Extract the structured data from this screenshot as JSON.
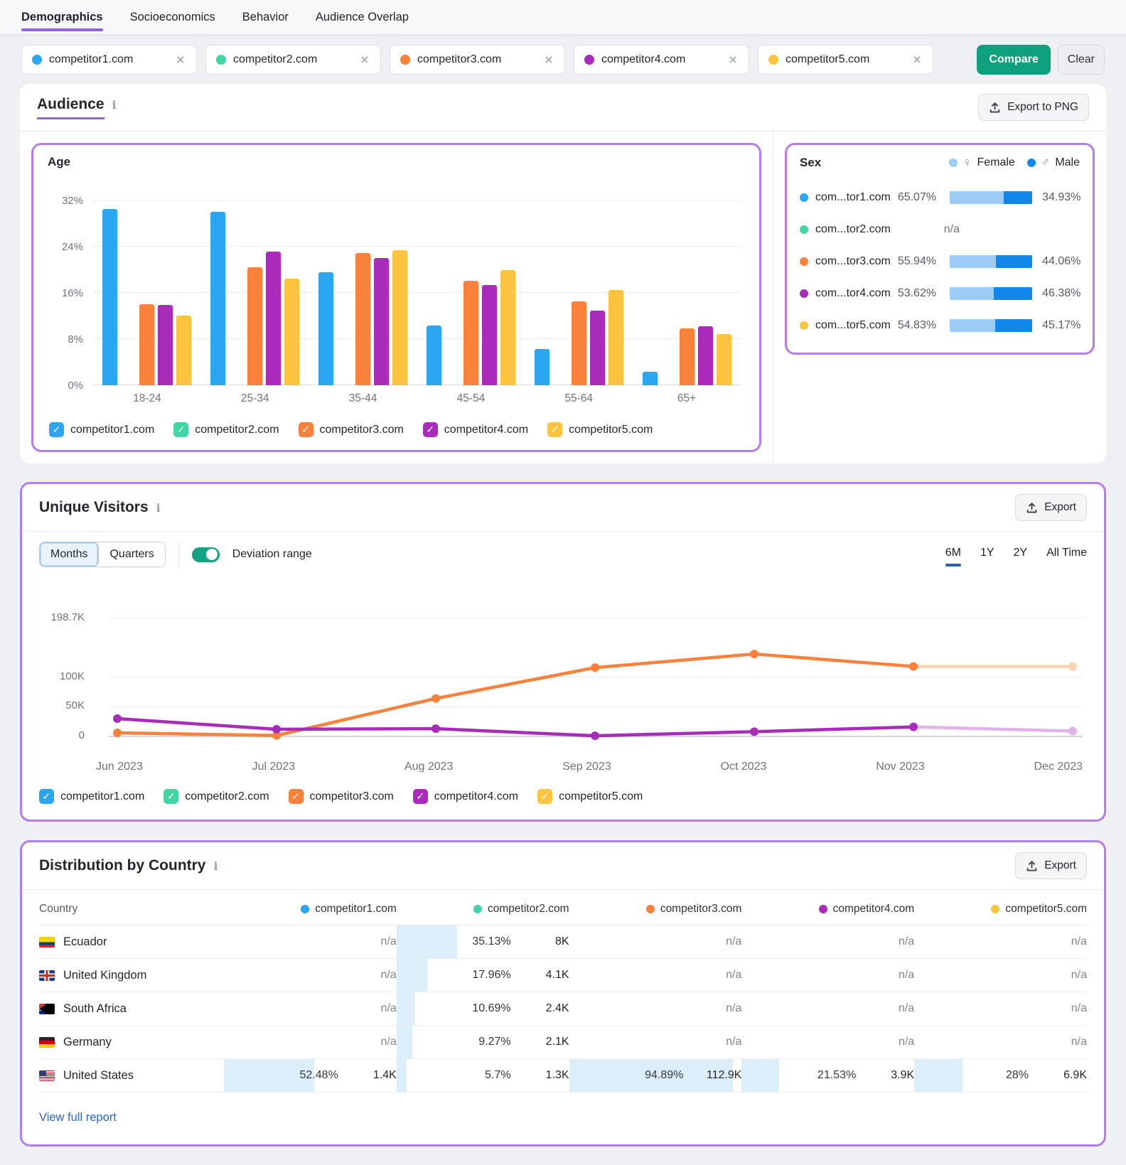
{
  "nav": {
    "tabs": [
      {
        "label": "Demographics",
        "active": true
      },
      {
        "label": "Socioeconomics",
        "active": false
      },
      {
        "label": "Behavior",
        "active": false
      },
      {
        "label": "Audience Overlap",
        "active": false
      }
    ]
  },
  "icons": {
    "close": "×",
    "check": "✓",
    "info": "i"
  },
  "colors": {
    "accent_purple": "#9660dd",
    "panel_border": "#b37ee9",
    "blue": "#2ba6f0",
    "green": "#43d6a4",
    "orange": "#f8813c",
    "magenta": "#a92bba",
    "yellow": "#fbc43e",
    "male_blue": "#1287ea",
    "female_blue": "#9ccbf5",
    "compare_green": "#0fa17e",
    "link_blue": "#2a66c8",
    "highlight_blue": "#ddeefb"
  },
  "competitors": [
    {
      "name": "competitor1.com",
      "color": "#2ba6f0"
    },
    {
      "name": "competitor2.com",
      "color": "#43d6a4"
    },
    {
      "name": "competitor3.com",
      "color": "#f8813c"
    },
    {
      "name": "competitor4.com",
      "color": "#a92bba"
    },
    {
      "name": "competitor5.com",
      "color": "#fbc43e"
    }
  ],
  "toolbar": {
    "compare_label": "Compare",
    "clear_label": "Clear"
  },
  "audience": {
    "title": "Audience",
    "export_label": "Export to PNG",
    "age_title": "Age"
  },
  "sex": {
    "title": "Sex",
    "legend": {
      "female_symbol": "♀",
      "female_label": "Female",
      "male_symbol": "♂",
      "male_label": "Male"
    },
    "rows": [
      {
        "domain": "com...tor1.com",
        "female": "65.07%",
        "male": "34.93%",
        "female_pct": 65.07
      },
      {
        "domain": "com...tor2.com",
        "na": "n/a"
      },
      {
        "domain": "com...tor3.com",
        "female": "55.94%",
        "male": "44.06%",
        "female_pct": 55.94
      },
      {
        "domain": "com...tor4.com",
        "female": "53.62%",
        "male": "46.38%",
        "female_pct": 53.62
      },
      {
        "domain": "com...tor5.com",
        "female": "54.83%",
        "male": "45.17%",
        "female_pct": 54.83
      }
    ]
  },
  "unique_visitors": {
    "title": "Unique Visitors",
    "export_label": "Export",
    "view_toggle": [
      {
        "label": "Months",
        "active": true
      },
      {
        "label": "Quarters",
        "active": false
      }
    ],
    "deviation_label": "Deviation range",
    "deviation_on": true,
    "ranges": [
      {
        "label": "6M",
        "active": true
      },
      {
        "label": "1Y",
        "active": false
      },
      {
        "label": "2Y",
        "active": false
      },
      {
        "label": "All Time",
        "active": false
      }
    ]
  },
  "chart_data": [
    {
      "type": "bar",
      "title": "Age",
      "categories": [
        "18-24",
        "25-34",
        "35-44",
        "45-54",
        "55-64",
        "65+"
      ],
      "series": [
        {
          "name": "competitor1.com",
          "color": "#2ba6f0",
          "values": [
            30.6,
            30.1,
            19.6,
            10.4,
            6.3,
            2.4
          ]
        },
        {
          "name": "competitor2.com",
          "color": "#43d6a4",
          "values": [
            null,
            null,
            null,
            null,
            null,
            null
          ]
        },
        {
          "name": "competitor3.com",
          "color": "#f8813c",
          "values": [
            14.0,
            20.4,
            22.9,
            18.1,
            14.5,
            9.8
          ]
        },
        {
          "name": "competitor4.com",
          "color": "#a92bba",
          "values": [
            13.9,
            23.2,
            22.1,
            17.4,
            12.9,
            10.2
          ]
        },
        {
          "name": "competitor5.com",
          "color": "#fbc43e",
          "values": [
            12.1,
            18.5,
            23.4,
            19.9,
            16.5,
            8.9
          ]
        }
      ],
      "yticks": [
        {
          "label": "0%",
          "value": 0
        },
        {
          "label": "8%",
          "value": 8
        },
        {
          "label": "16%",
          "value": 16
        },
        {
          "label": "24%",
          "value": 24
        },
        {
          "label": "32%",
          "value": 32
        }
      ],
      "ylim": [
        0,
        33
      ],
      "grid": true,
      "legend_position": "bottom",
      "unit": "percent of audience"
    },
    {
      "type": "line",
      "title": "Unique Visitors",
      "x": [
        "Jun 2023",
        "Jul 2023",
        "Aug 2023",
        "Sep 2023",
        "Oct 2023",
        "Nov 2023",
        "Dec 2023"
      ],
      "series": [
        {
          "name": "competitor3.com",
          "color": "#f8813c",
          "faded_color": "#fad4b4",
          "values": [
            6000,
            1500,
            64000,
            116000,
            139000,
            118000,
            118000
          ]
        },
        {
          "name": "competitor4.com",
          "color": "#a92bba",
          "faded_color": "#e0b4ea",
          "values": [
            30000,
            12000,
            13000,
            1000,
            8000,
            16000,
            9000
          ]
        }
      ],
      "yticks": [
        {
          "label": "0",
          "value": 0
        },
        {
          "label": "50K",
          "value": 50000
        },
        {
          "label": "100K",
          "value": 100000
        },
        {
          "label": "198.7K",
          "value": 198700
        }
      ],
      "ylim": [
        0,
        235000
      ],
      "grid": true,
      "note": "Nov-to-Dec segment rendered faded (deviation range projection)"
    }
  ],
  "country": {
    "title": "Distribution by Country",
    "export_label": "Export",
    "country_header": "Country",
    "rows": [
      {
        "country": "Ecuador",
        "flag": "ec",
        "cells": [
          {
            "na": "n/a"
          },
          {
            "pct": "35.13%",
            "value": "8K",
            "fill_pct": 35.13
          },
          {
            "na": "n/a"
          },
          {
            "na": "n/a"
          },
          {
            "na": "n/a"
          }
        ]
      },
      {
        "country": "United Kingdom",
        "flag": "gb",
        "cells": [
          {
            "na": "n/a"
          },
          {
            "pct": "17.96%",
            "value": "4.1K",
            "fill_pct": 17.96
          },
          {
            "na": "n/a"
          },
          {
            "na": "n/a"
          },
          {
            "na": "n/a"
          }
        ]
      },
      {
        "country": "South Africa",
        "flag": "za",
        "cells": [
          {
            "na": "n/a"
          },
          {
            "pct": "10.69%",
            "value": "2.4K",
            "fill_pct": 10.69
          },
          {
            "na": "n/a"
          },
          {
            "na": "n/a"
          },
          {
            "na": "n/a"
          }
        ]
      },
      {
        "country": "Germany",
        "flag": "de",
        "cells": [
          {
            "na": "n/a"
          },
          {
            "pct": "9.27%",
            "value": "2.1K",
            "fill_pct": 9.27
          },
          {
            "na": "n/a"
          },
          {
            "na": "n/a"
          },
          {
            "na": "n/a"
          }
        ]
      },
      {
        "country": "United States",
        "flag": "us",
        "cells": [
          {
            "pct": "52.48%",
            "value": "1.4K",
            "fill_pct": 52.48
          },
          {
            "pct": "5.7%",
            "value": "1.3K",
            "fill_pct": 5.7
          },
          {
            "pct": "94.89%",
            "value": "112.9K",
            "fill_pct": 94.89
          },
          {
            "pct": "21.53%",
            "value": "3.9K",
            "fill_pct": 21.53
          },
          {
            "pct": "28%",
            "value": "6.9K",
            "fill_pct": 28
          }
        ]
      }
    ],
    "view_full_report": "View full report"
  }
}
